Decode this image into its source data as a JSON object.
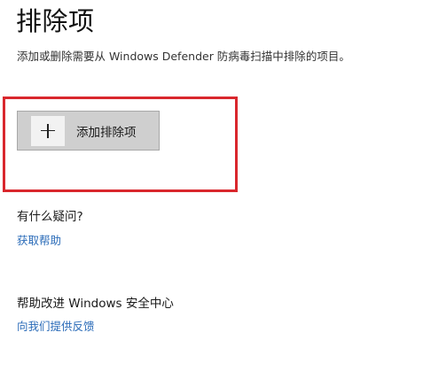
{
  "page": {
    "title": "排除项",
    "description": "添加或删除需要从 Windows Defender 防病毒扫描中排除的项目。"
  },
  "add_exclusion": {
    "icon": "plus-icon",
    "label": "添加排除项"
  },
  "help": {
    "heading": "有什么疑问?",
    "link": "获取帮助"
  },
  "feedback": {
    "heading": "帮助改进 Windows 安全中心",
    "link": "向我们提供反馈"
  },
  "colors": {
    "highlight_border": "#d9272d",
    "link": "#2a6bb8",
    "button_bg": "#cfcfcf"
  }
}
